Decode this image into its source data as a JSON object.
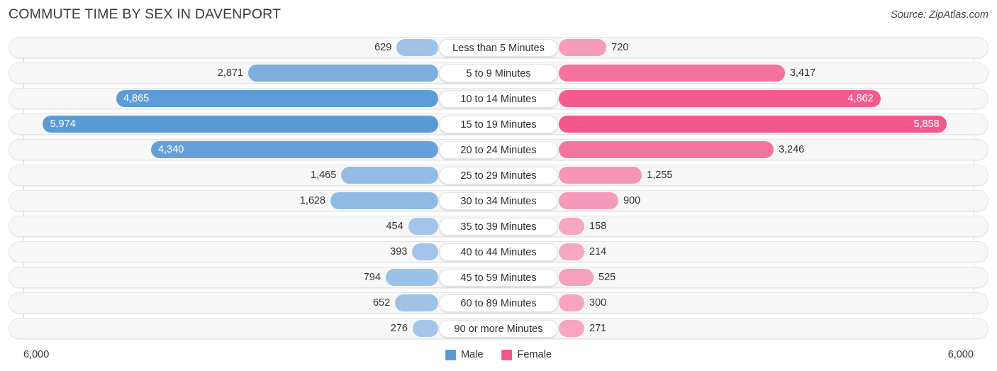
{
  "header": {
    "title": "COMMUTE TIME BY SEX IN DAVENPORT",
    "source": "Source: ZipAtlas.com"
  },
  "axis": {
    "min_label": "6,000",
    "max_label": "6,000"
  },
  "legend": {
    "items": [
      {
        "label": "Male",
        "color": "#5b9bd5"
      },
      {
        "label": "Female",
        "color": "#f2588e"
      }
    ]
  },
  "colors": {
    "male_light": "#a9c9ea",
    "male_dark": "#5b9bd5",
    "female_light": "#f7a9c5",
    "female_dark": "#f2588e",
    "track": "#f7f7f7",
    "gridline": "#dcdcdc"
  },
  "chart_data": {
    "type": "bar",
    "title": "COMMUTE TIME BY SEX IN DAVENPORT",
    "subtitle": "Source: ZipAtlas.com",
    "orientation": "horizontal-diverging",
    "xlabel": "",
    "ylabel": "",
    "xlim": [
      6000,
      6000
    ],
    "axis_max": 6000,
    "grid": true,
    "legend_position": "bottom-center",
    "categories": [
      "Less than 5 Minutes",
      "5 to 9 Minutes",
      "10 to 14 Minutes",
      "15 to 19 Minutes",
      "20 to 24 Minutes",
      "25 to 29 Minutes",
      "30 to 34 Minutes",
      "35 to 39 Minutes",
      "40 to 44 Minutes",
      "45 to 59 Minutes",
      "60 to 89 Minutes",
      "90 or more Minutes"
    ],
    "series": [
      {
        "name": "Male",
        "side": "left",
        "color": "#5b9bd5",
        "values": [
          629,
          2871,
          4865,
          5974,
          4340,
          1465,
          1628,
          454,
          393,
          794,
          652,
          276
        ],
        "labels": [
          "629",
          "2,871",
          "4,865",
          "5,974",
          "4,340",
          "1,465",
          "1,628",
          "454",
          "393",
          "794",
          "652",
          "276"
        ]
      },
      {
        "name": "Female",
        "side": "right",
        "color": "#f2588e",
        "values": [
          720,
          3417,
          4862,
          5858,
          3246,
          1255,
          900,
          158,
          214,
          525,
          300,
          271
        ],
        "labels": [
          "720",
          "3,417",
          "4,862",
          "5,858",
          "3,246",
          "1,255",
          "900",
          "158",
          "214",
          "525",
          "300",
          "271"
        ]
      }
    ],
    "rows": [
      {
        "category": "Less than 5 Minutes",
        "male": 629,
        "male_label": "629",
        "female": 720,
        "female_label": "720"
      },
      {
        "category": "5 to 9 Minutes",
        "male": 2871,
        "male_label": "2,871",
        "female": 3417,
        "female_label": "3,417"
      },
      {
        "category": "10 to 14 Minutes",
        "male": 4865,
        "male_label": "4,865",
        "female": 4862,
        "female_label": "4,862"
      },
      {
        "category": "15 to 19 Minutes",
        "male": 5974,
        "male_label": "5,974",
        "female": 5858,
        "female_label": "5,858"
      },
      {
        "category": "20 to 24 Minutes",
        "male": 4340,
        "male_label": "4,340",
        "female": 3246,
        "female_label": "3,246"
      },
      {
        "category": "25 to 29 Minutes",
        "male": 1465,
        "male_label": "1,465",
        "female": 1255,
        "female_label": "1,255"
      },
      {
        "category": "30 to 34 Minutes",
        "male": 1628,
        "male_label": "1,628",
        "female": 900,
        "female_label": "900"
      },
      {
        "category": "35 to 39 Minutes",
        "male": 454,
        "male_label": "454",
        "female": 158,
        "female_label": "158"
      },
      {
        "category": "40 to 44 Minutes",
        "male": 393,
        "male_label": "393",
        "female": 214,
        "female_label": "214"
      },
      {
        "category": "45 to 59 Minutes",
        "male": 794,
        "male_label": "794",
        "female": 525,
        "female_label": "525"
      },
      {
        "category": "60 to 89 Minutes",
        "male": 652,
        "male_label": "652",
        "female": 300,
        "female_label": "300"
      },
      {
        "category": "90 or more Minutes",
        "male": 276,
        "male_label": "276",
        "female": 271,
        "female_label": "271"
      }
    ]
  }
}
